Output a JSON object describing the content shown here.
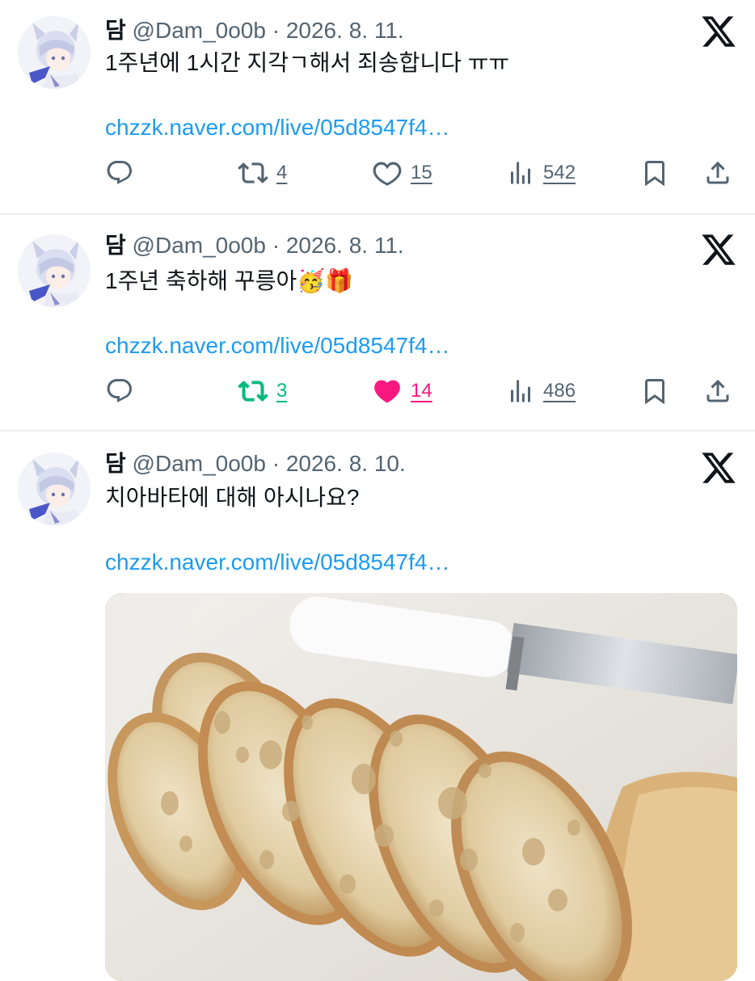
{
  "tweets": [
    {
      "name": "담",
      "handle": "@Dam_0o0b",
      "separator": "·",
      "date": "2026. 8. 11.",
      "text": "1주년에 1시간 지각ㄱ해서 죄송합니다 ㅠㅠ",
      "link": "chzzk.naver.com/live/05d8547f4…",
      "retweets": "4",
      "likes": "15",
      "views": "542",
      "retweeted": false,
      "liked": false
    },
    {
      "name": "담",
      "handle": "@Dam_0o0b",
      "separator": "·",
      "date": "2026. 8. 11.",
      "text": "1주년 축하해 꾸릉아",
      "emojis": "🥳🎁",
      "link": "chzzk.naver.com/live/05d8547f4…",
      "retweets": "3",
      "likes": "14",
      "views": "486",
      "retweeted": true,
      "liked": true
    },
    {
      "name": "담",
      "handle": "@Dam_0o0b",
      "separator": "·",
      "date": "2026. 8. 10.",
      "text": "치아바타에 대해 아시나요?",
      "link": "chzzk.naver.com/live/05d8547f4…",
      "media": "sliced-ciabatta-bread-photo"
    }
  ],
  "colors": {
    "link": "#1d9bf0",
    "muted": "#536471",
    "retweet_active": "#00ba7c",
    "like_active": "#f91880"
  },
  "icons": [
    "reply-icon",
    "retweet-icon",
    "like-icon",
    "views-icon",
    "bookmark-icon",
    "share-icon",
    "x-logo-icon"
  ]
}
